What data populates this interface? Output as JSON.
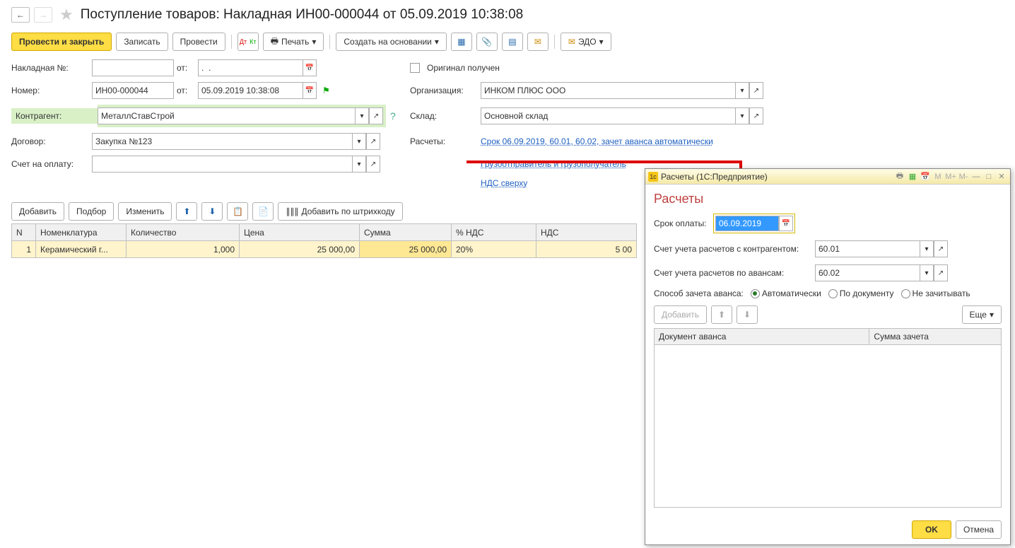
{
  "header": {
    "title": "Поступление товаров: Накладная ИН00-000044 от 05.09.2019 10:38:08"
  },
  "toolbar": {
    "post_close": "Провести и закрыть",
    "save": "Записать",
    "post": "Провести",
    "print": "Печать",
    "create_based": "Создать на основании",
    "edo": "ЭДО"
  },
  "form": {
    "invoice_label": "Накладная №:",
    "invoice_no": "",
    "from": "от:",
    "invoice_date": ".  .",
    "number_label": "Номер:",
    "number": "ИН00-000044",
    "date": "05.09.2019 10:38:08",
    "counterparty_label": "Контрагент:",
    "counterparty": "МеталлСтавСтрой",
    "contract_label": "Договор:",
    "contract": "Закупка №123",
    "invoice_pay_label": "Счет на оплату:",
    "invoice_pay": "",
    "original_received": "Оригинал получен",
    "org_label": "Организация:",
    "org": "ИНКОМ ПЛЮС ООО",
    "warehouse_label": "Склад:",
    "warehouse": "Основной склад",
    "settlements_label": "Расчеты:",
    "settlements_link": "Срок 06.09.2019, 60.01, 60.02, зачет аванса автоматически",
    "shipper_link": "Грузоотправитель и грузополучатель",
    "vat_link": "НДС сверху"
  },
  "table_toolbar": {
    "add": "Добавить",
    "pick": "Подбор",
    "edit": "Изменить",
    "barcode": "Добавить по штрихкоду"
  },
  "table": {
    "headers": {
      "n": "N",
      "item": "Номенклатура",
      "qty": "Количество",
      "price": "Цена",
      "sum": "Сумма",
      "vat_pct": "% НДС",
      "vat": "НДС"
    },
    "rows": [
      {
        "n": "1",
        "item": "Керамический г...",
        "qty": "1,000",
        "price": "25 000,00",
        "sum": "25 000,00",
        "vat_pct": "20%",
        "vat": "5 00"
      }
    ]
  },
  "dialog": {
    "titlebar": "Расчеты (1С:Предприятие)",
    "title": "Расчеты",
    "payment_due_label": "Срок оплаты:",
    "payment_due": "06.09.2019",
    "account_counterparty_label": "Счет учета расчетов с контрагентом:",
    "account_counterparty": "60.01",
    "account_advance_label": "Счет учета расчетов по авансам:",
    "account_advance": "60.02",
    "advance_method_label": "Способ зачета аванса:",
    "advance_options": {
      "auto": "Автоматически",
      "by_doc": "По документу",
      "none": "Не зачитывать"
    },
    "add": "Добавить",
    "more": "Еще",
    "tbl_doc": "Документ аванса",
    "tbl_sum": "Сумма зачета",
    "ok": "OK",
    "cancel": "Отмена",
    "m": "M",
    "mplus": "M+",
    "mminus": "M-"
  }
}
